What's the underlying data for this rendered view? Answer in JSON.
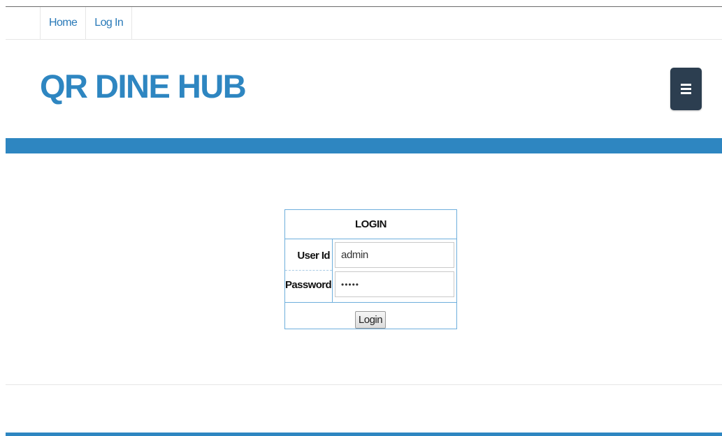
{
  "nav": {
    "items": [
      {
        "label": "Home"
      },
      {
        "label": "Log In"
      }
    ]
  },
  "header": {
    "site_title": "QR DINE HUB",
    "menu_icon": "hamburger-menu-icon"
  },
  "login": {
    "title": "LOGIN",
    "user_label": "User Id",
    "user_value": "admin",
    "password_label": "Password",
    "password_value": "admin",
    "button_label": "Login"
  },
  "colors": {
    "brand_blue": "#2e86c1",
    "menu_button": "#2c3e50",
    "link": "#2a7ab8"
  }
}
